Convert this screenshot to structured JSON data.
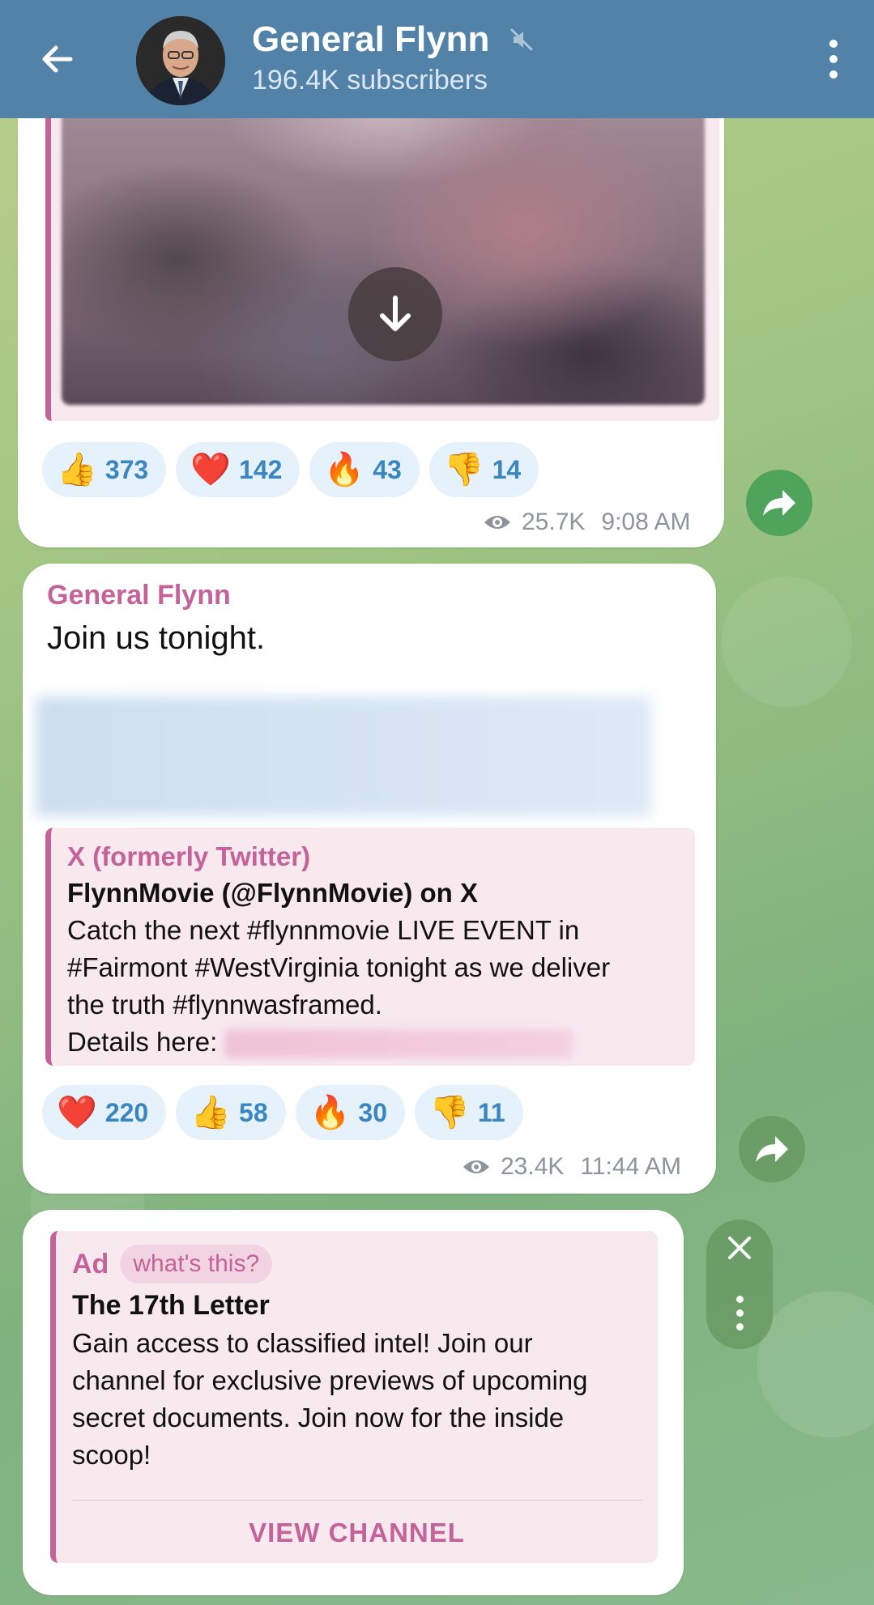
{
  "header": {
    "title": "General Flynn",
    "subscribers": "196.4K subscribers",
    "muted_icon": "muted-speaker-icon"
  },
  "post1": {
    "reactions": [
      {
        "emoji": "👍",
        "count": "373",
        "name": "thumbs-up"
      },
      {
        "emoji": "❤️",
        "count": "142",
        "name": "heart"
      },
      {
        "emoji": "🔥",
        "count": "43",
        "name": "fire"
      },
      {
        "emoji": "👎",
        "count": "14",
        "name": "thumbs-down"
      }
    ],
    "views": "25.7K",
    "time": "9:08 AM"
  },
  "post2": {
    "sender": "General Flynn",
    "text": "Join us tonight.",
    "preview": {
      "site": "X (formerly Twitter)",
      "title": "FlynnMovie (@FlynnMovie) on X",
      "desc_line1": "Catch the next #flynnmovie LIVE EVENT in",
      "desc_line2": "#Fairmont #WestVirginia tonight as we deliver",
      "desc_line3": "the truth #flynnwasframed.",
      "details_label": "Details here:"
    },
    "reactions": [
      {
        "emoji": "❤️",
        "count": "220",
        "name": "heart"
      },
      {
        "emoji": "👍",
        "count": "58",
        "name": "thumbs-up"
      },
      {
        "emoji": "🔥",
        "count": "30",
        "name": "fire"
      },
      {
        "emoji": "👎",
        "count": "11",
        "name": "thumbs-down"
      }
    ],
    "views": "23.4K",
    "time": "11:44 AM"
  },
  "ad": {
    "label": "Ad",
    "whats_this": "what's this?",
    "title": "The 17th Letter",
    "desc_line1": "Gain access to classified intel! Join our",
    "desc_line2": "channel for exclusive previews of upcoming",
    "desc_line3": "secret documents. Join now for the inside",
    "desc_line4": "scoop!",
    "button": "VIEW CHANNEL"
  },
  "colors": {
    "header": "#5282a8",
    "accent": "#c4629a",
    "reaction_bg": "#e6f2fb",
    "reaction_text": "#3a86c0"
  }
}
